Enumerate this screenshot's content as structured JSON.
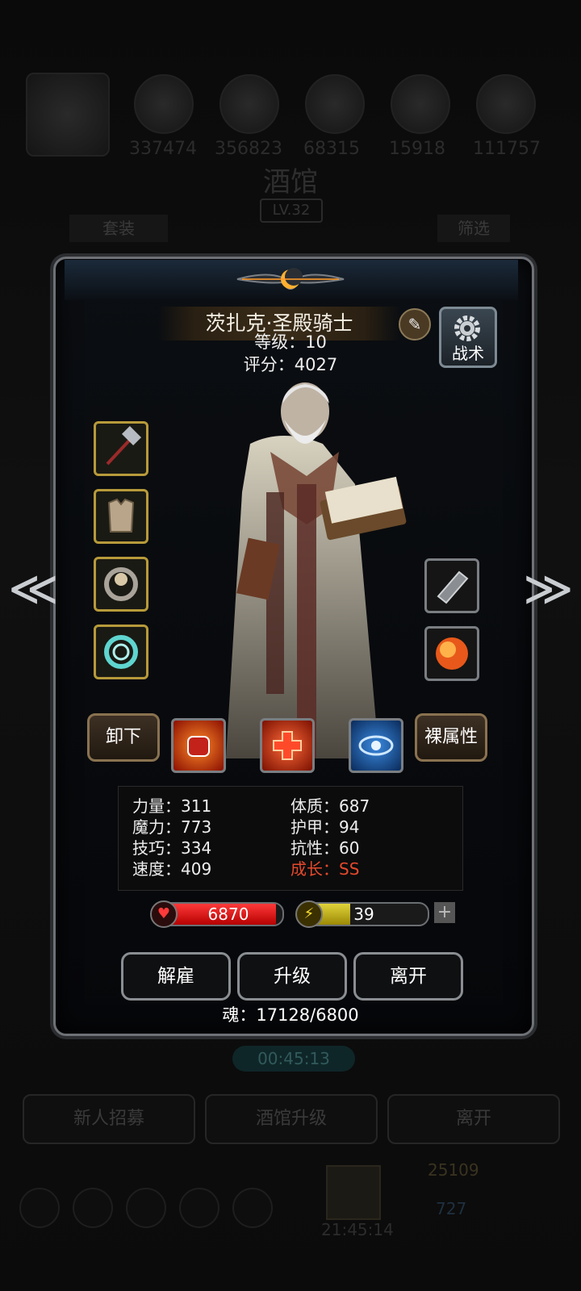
{
  "background": {
    "resources": [
      "337474",
      "356823",
      "68315",
      "15918",
      "111757"
    ],
    "title": "酒馆",
    "level": "LV.32",
    "tab_left": "套装",
    "tab_right": "筛选",
    "timer": "00:45:13",
    "buttons": [
      "新人招募",
      "酒馆升级",
      "离开"
    ],
    "bottom_numbers": [
      "25109",
      "727"
    ],
    "bottom_time": "21:45:14"
  },
  "hero": {
    "name": "茨扎克·圣殿骑士",
    "level_label": "等级：10",
    "score_label": "评分：4027",
    "tactic_label": "战术",
    "left_slots": [
      "hammer-icon",
      "chest-armor-icon",
      "ring-icon",
      "amulet-icon"
    ],
    "right_slots": [
      "gauntlet-icon",
      "fire-orb-icon"
    ]
  },
  "actions": {
    "unequip": "卸下",
    "bare_stats": "裸属性",
    "skills": [
      "fist-skill-icon",
      "heal-cross-skill-icon",
      "eye-skill-icon"
    ]
  },
  "stats": {
    "strength": "力量：311",
    "magic": "魔力：773",
    "skill": "技巧：334",
    "speed": "速度：409",
    "constitution": "体质：687",
    "armor": "护甲：94",
    "resistance": "抗性：60",
    "growth": "成长：SS",
    "growth_color": "#e5492c"
  },
  "bars": {
    "hp": "6870",
    "hp_fill": 0.95,
    "energy": "39",
    "energy_fill": 0.39
  },
  "buttons": {
    "dismiss": "解雇",
    "upgrade": "升级",
    "leave": "离开"
  },
  "soul": "魂：17128/6800",
  "nav": {
    "prev": "≪",
    "next": "≫"
  }
}
